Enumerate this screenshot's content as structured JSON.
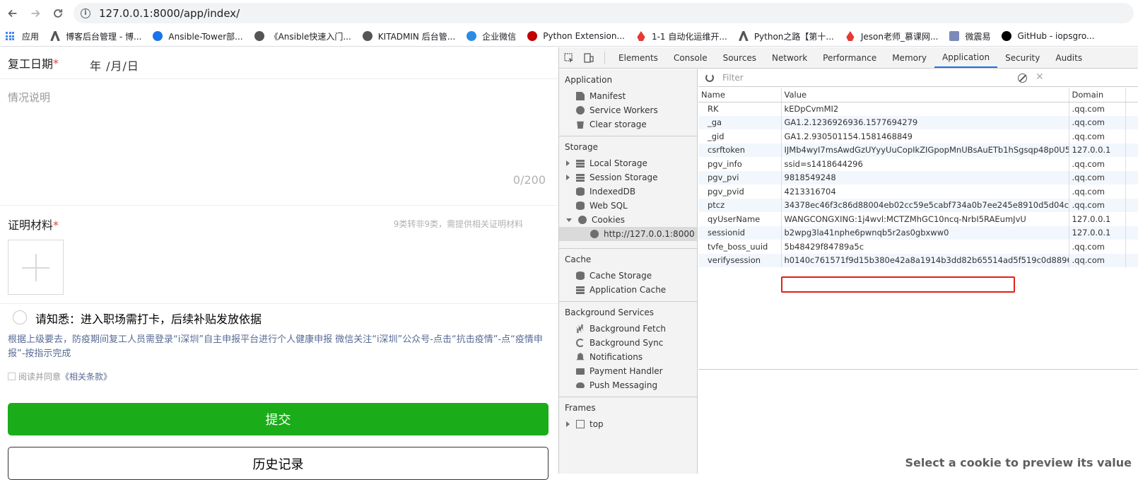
{
  "browser": {
    "url": "127.0.0.1:8000/app/index/",
    "bookmarks": [
      {
        "label": "应用",
        "icon": "apps-grid-icon"
      },
      {
        "label": "博客后台管理 - 博...",
        "icon": "logo-icon",
        "color": "#555555"
      },
      {
        "label": "Ansible-Tower部...",
        "icon": "h-logo-icon",
        "color": "#1a73e8"
      },
      {
        "label": "《Ansible快速入门...",
        "icon": "globe-icon",
        "color": "#555555"
      },
      {
        "label": "KITADMIN 后台管...",
        "icon": "globe-icon",
        "color": "#555555"
      },
      {
        "label": "企业微信",
        "icon": "wecom-icon",
        "color": "#2b8ce6"
      },
      {
        "label": "Python Extension...",
        "icon": "record-icon",
        "color": "#c00000"
      },
      {
        "label": "1-1 自动化运维开...",
        "icon": "flame-icon",
        "color": "#e53935"
      },
      {
        "label": "Python之路【第十...",
        "icon": "logo-icon",
        "color": "#555555"
      },
      {
        "label": "Jeson老师_慕课网...",
        "icon": "flame-icon",
        "color": "#e53935"
      },
      {
        "label": "微震易",
        "icon": "doc-icon",
        "color": "#7b8ab8"
      },
      {
        "label": "GitHub - iopsgro...",
        "icon": "github-icon",
        "color": "#000000"
      }
    ]
  },
  "form": {
    "date_label": "复工日期",
    "required_mark": "*",
    "date_value": "年 /月/日",
    "desc_placeholder": "情况说明",
    "desc_count": "0/200",
    "proof_label": "证明材料",
    "proof_hint": "9类转非9类，需提供相关证明材料",
    "notice_title": "请知悉：进入职场需打卡，后续补贴发放依据",
    "notice_body": "根据上级要去，防疫期间复工人员需登录“i深圳”自主申报平台进行个人健康申报 微信关注“i深圳”公众号-点击“抗击疫情”-点“疫情申报”-按指示完成",
    "agree_text": "阅读并同意",
    "agree_link": "《相关条款》",
    "submit_label": "提交",
    "history_label": "历史记录",
    "submit_color": "#1aad19"
  },
  "devtools": {
    "tabs": [
      "Elements",
      "Console",
      "Sources",
      "Network",
      "Performance",
      "Memory",
      "Application",
      "Security",
      "Audits"
    ],
    "active_tab": "Application",
    "sidebar": {
      "application_head": "Application",
      "application_items": [
        "Manifest",
        "Service Workers",
        "Clear storage"
      ],
      "storage_head": "Storage",
      "storage_items": [
        "Local Storage",
        "Session Storage",
        "IndexedDB",
        "Web SQL",
        "Cookies"
      ],
      "cookie_origin": "http://127.0.0.1:8000",
      "cache_head": "Cache",
      "cache_items": [
        "Cache Storage",
        "Application Cache"
      ],
      "bg_head": "Background Services",
      "bg_items": [
        "Background Fetch",
        "Background Sync",
        "Notifications",
        "Payment Handler",
        "Push Messaging"
      ],
      "frames_head": "Frames",
      "frames_items": [
        "top"
      ]
    },
    "filter_placeholder": "Filter",
    "columns": [
      "Name",
      "Value",
      "Domain"
    ],
    "cookies": [
      {
        "name": "RK",
        "value": "kEDpCvmMI2",
        "domain": ".qq.com"
      },
      {
        "name": "_ga",
        "value": "GA1.2.1236926936.1577694279",
        "domain": ".qq.com"
      },
      {
        "name": "_gid",
        "value": "GA1.2.930501154.1581468849",
        "domain": ".qq.com"
      },
      {
        "name": "csrftoken",
        "value": "IJMb4wyI7msAwdGzUYyyUuCopIkZIGpopMnUBsAuETb1hSgsqp48p0U5Krq...",
        "domain": "127.0.0.1"
      },
      {
        "name": "pgv_info",
        "value": "ssid=s1418644296",
        "domain": ".qq.com"
      },
      {
        "name": "pgv_pvi",
        "value": "9818549248",
        "domain": ".qq.com"
      },
      {
        "name": "pgv_pvid",
        "value": "4213316704",
        "domain": ".qq.com"
      },
      {
        "name": "ptcz",
        "value": "34378ec46f3c86d88004eb02cc59e5cabf734a0b7ee245e8910d5d04c6aa9ecf",
        "domain": ".qq.com"
      },
      {
        "name": "qyUserName",
        "value": "WANGCONGXING:1j4wvl:MCTZMhGC10ncq-NrbI5RAEumJvU",
        "domain": "127.0.0.1"
      },
      {
        "name": "sessionid",
        "value": "b2wpg3la41nphe6pwnqb5r2as0gbxww0",
        "domain": "127.0.0.1"
      },
      {
        "name": "tvfe_boss_uuid",
        "value": "5b48429f84789a5c",
        "domain": ".qq.com"
      },
      {
        "name": "verifysession",
        "value": "h0140c761571f9d15b380e42a8a1914b3dd82b65514ad5f519c0d88961ef7f0...",
        "domain": ".qq.com"
      }
    ],
    "highlight_color": "#e0201a",
    "preview_text": "Select a cookie to preview its value"
  }
}
